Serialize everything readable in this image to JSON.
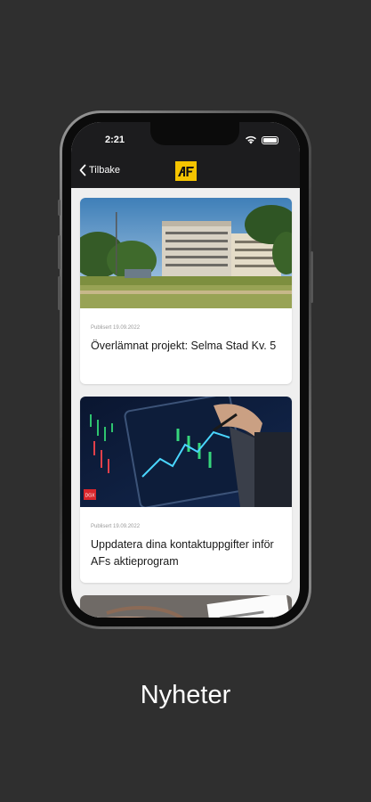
{
  "status_bar": {
    "time": "2:21"
  },
  "nav": {
    "back_label": "Tilbake",
    "logo_text": "AF"
  },
  "articles": [
    {
      "date": "Publisert 19.09.2022",
      "title": "Överlämnat projekt: Selma Stad Kv. 5"
    },
    {
      "date": "Publisert 19.09.2022",
      "title": "Uppdatera dina kontaktuppgifter inför AFs aktieprogram",
      "badge": "DGX"
    }
  ],
  "caption": "Nyheter",
  "colors": {
    "background": "#2f2f2f",
    "navbar": "#1c1c1e",
    "logo": "#f5c400",
    "card_bg": "#ffffff"
  }
}
